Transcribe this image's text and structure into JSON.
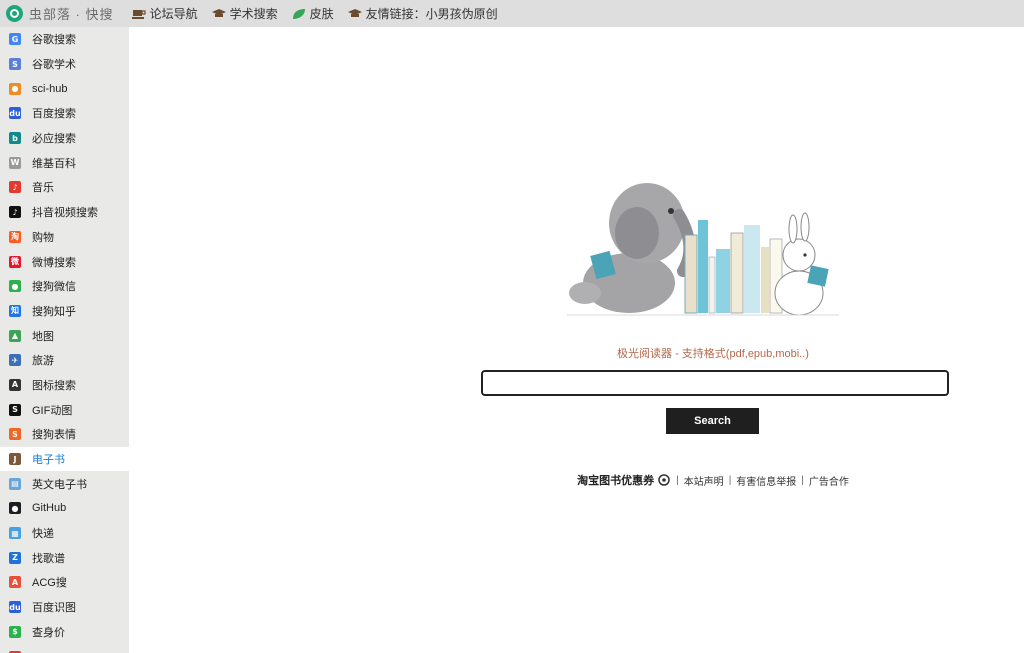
{
  "topbar": {
    "logo_text": "虫部落 · 快搜",
    "links": [
      {
        "label": "论坛导航",
        "icon": "coffee-cup-icon"
      },
      {
        "label": "学术搜索",
        "icon": "graduation-cap-icon"
      },
      {
        "label": "皮肤",
        "icon": "leaf-icon"
      },
      {
        "label": "友情链接：小男孩伪原创",
        "icon": "graduation-cap-icon"
      }
    ]
  },
  "sidebar": {
    "items": [
      {
        "label": "谷歌搜索",
        "icon": "google-icon",
        "glyph": "G",
        "color": "#4285f4"
      },
      {
        "label": "谷歌学术",
        "icon": "google-scholar-icon",
        "glyph": "S",
        "color": "#5b7fd6"
      },
      {
        "label": "sci-hub",
        "icon": "scihub-icon",
        "glyph": "●",
        "color": "#f08a24"
      },
      {
        "label": "百度搜索",
        "icon": "baidu-icon",
        "glyph": "du",
        "color": "#2c5fd8"
      },
      {
        "label": "必应搜索",
        "icon": "bing-icon",
        "glyph": "b",
        "color": "#138a8a"
      },
      {
        "label": "维基百科",
        "icon": "wikipedia-icon",
        "glyph": "W",
        "color": "#9a9a9a"
      },
      {
        "label": "音乐",
        "icon": "music-icon",
        "glyph": "♪",
        "color": "#e33a2f"
      },
      {
        "label": "抖音视频搜索",
        "icon": "douyin-icon",
        "glyph": "♪",
        "color": "#111111"
      },
      {
        "label": "购物",
        "icon": "taobao-icon",
        "glyph": "淘",
        "color": "#ff5a1f"
      },
      {
        "label": "微博搜索",
        "icon": "weibo-icon",
        "glyph": "微",
        "color": "#e6162d"
      },
      {
        "label": "搜狗微信",
        "icon": "wechat-icon",
        "glyph": "●",
        "color": "#2bb24c"
      },
      {
        "label": "搜狗知乎",
        "icon": "zhihu-icon",
        "glyph": "知",
        "color": "#1f74e8"
      },
      {
        "label": "地图",
        "icon": "map-icon",
        "glyph": "▲",
        "color": "#3aa655"
      },
      {
        "label": "旅游",
        "icon": "travel-icon",
        "glyph": "✈",
        "color": "#3d6fb6"
      },
      {
        "label": "图标搜索",
        "icon": "icon-search-icon",
        "glyph": "A",
        "color": "#333333"
      },
      {
        "label": "GIF动图",
        "icon": "gif-icon",
        "glyph": "S",
        "color": "#111111"
      },
      {
        "label": "搜狗表情",
        "icon": "sogou-emoji-icon",
        "glyph": "S",
        "color": "#f26522"
      },
      {
        "label": "电子书",
        "icon": "ebook-icon",
        "glyph": "J",
        "color": "#7a5a3a"
      },
      {
        "label": "英文电子书",
        "icon": "english-ebook-icon",
        "glyph": "▤",
        "color": "#6aa7d8"
      },
      {
        "label": "GitHub",
        "icon": "github-icon",
        "glyph": "●",
        "color": "#1b1f23"
      },
      {
        "label": "快递",
        "icon": "express-icon",
        "glyph": "▦",
        "color": "#4a9fe0"
      },
      {
        "label": "找歌谱",
        "icon": "sheet-music-icon",
        "glyph": "Z",
        "color": "#1e73d8"
      },
      {
        "label": "ACG搜",
        "icon": "acg-icon",
        "glyph": "A",
        "color": "#e8503a"
      },
      {
        "label": "百度识图",
        "icon": "baidu-image-icon",
        "glyph": "du",
        "color": "#2c5fd8"
      },
      {
        "label": "查身价",
        "icon": "price-check-icon",
        "glyph": "$",
        "color": "#2bb24c"
      },
      {
        "label": "",
        "icon": "list-item-icon",
        "glyph": "",
        "color": "#e33a2f"
      }
    ],
    "active_index": 17
  },
  "main": {
    "subtitle": "极光阅读器 - 支持格式(pdf,epub,mobi..)",
    "search": {
      "value": "",
      "placeholder": ""
    },
    "search_button": "Search",
    "footer": {
      "promo": "淘宝图书优惠券",
      "links": [
        "本站声明",
        "有害信息举报",
        "广告合作"
      ]
    }
  }
}
